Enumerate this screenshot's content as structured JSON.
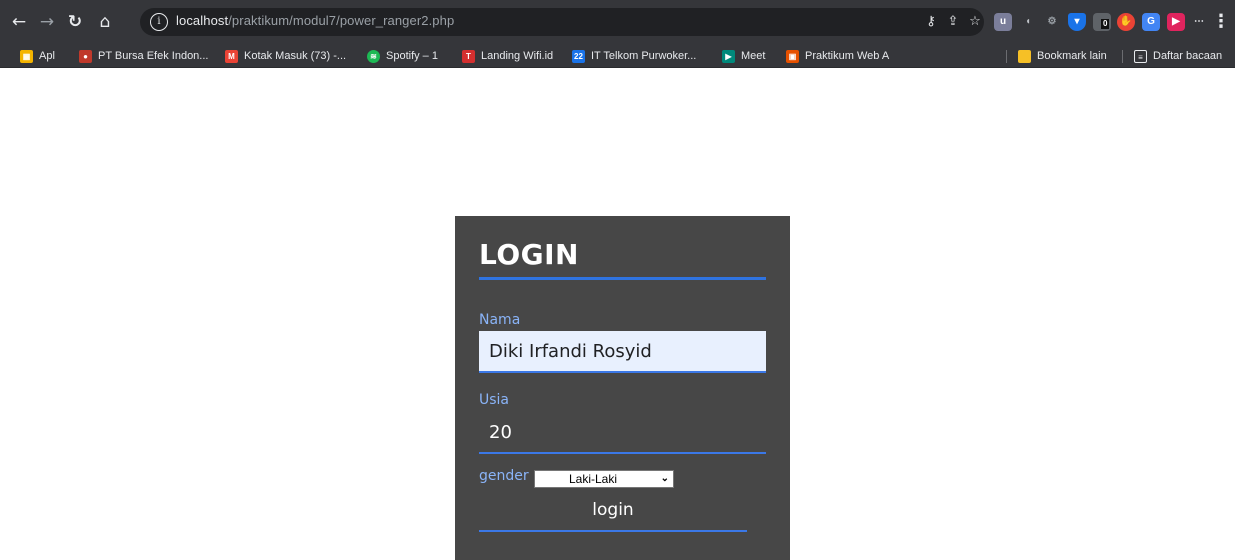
{
  "browser": {
    "url_host": "localhost",
    "url_path": "/praktikum/modul7/power_ranger2.php",
    "bookmarks": [
      {
        "label": "Apl",
        "color": "#f4b400",
        "glyph": "▦"
      },
      {
        "label": "PT Bursa Efek Indon...",
        "color": "#c0392b",
        "glyph": "●"
      },
      {
        "label": "Kotak Masuk (73) -...",
        "color": "#ea4335",
        "glyph": "M"
      },
      {
        "label": "Spotify – 1",
        "color": "#1db954",
        "glyph": "≋"
      },
      {
        "label": "Landing Wifi.id",
        "color": "#d32f2f",
        "glyph": "T"
      },
      {
        "label": "IT Telkom Purwoker...",
        "color": "#1a73e8",
        "glyph": "22"
      },
      {
        "label": "Meet",
        "color": "#00897b",
        "glyph": "▶"
      },
      {
        "label": "Praktikum Web A",
        "color": "#e65100",
        "glyph": "▣"
      }
    ],
    "bookmark_other": "Bookmark lain",
    "reading_list": "Daftar bacaan",
    "ext_badge": "0"
  },
  "form": {
    "title": "LOGIN",
    "nama_label": "Nama",
    "nama_value": "Diki Irfandi Rosyid",
    "usia_label": "Usia",
    "usia_value": "20",
    "gender_label": "gender",
    "gender_selected": "Laki-Laki",
    "submit_label": "login"
  },
  "colors": {
    "accent": "#2f73e0",
    "card_bg": "#474747",
    "label": "#8ab4f8"
  }
}
